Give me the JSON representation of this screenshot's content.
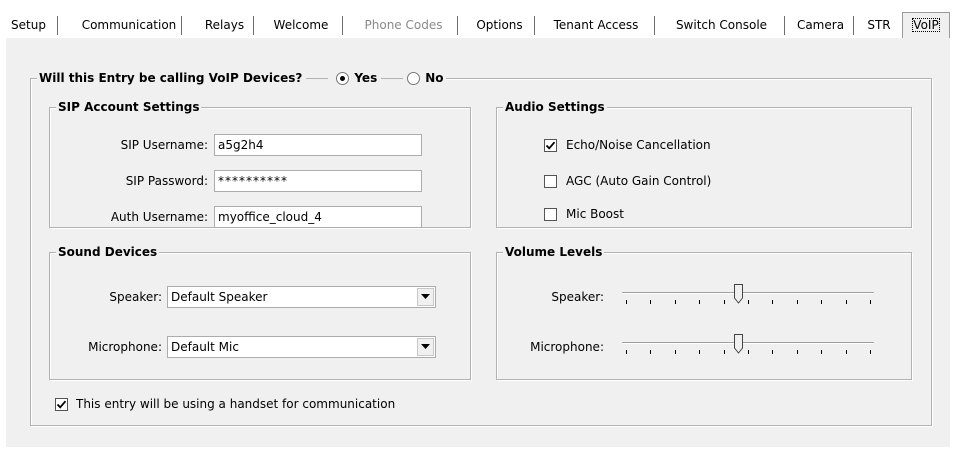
{
  "tabs": [
    {
      "label": "Setup",
      "state": "normal"
    },
    {
      "label": "Communication",
      "state": "normal"
    },
    {
      "label": "Relays",
      "state": "normal"
    },
    {
      "label": "Welcome",
      "state": "normal"
    },
    {
      "label": "Phone Codes",
      "state": "disabled"
    },
    {
      "label": "Options",
      "state": "normal"
    },
    {
      "label": "Tenant Access",
      "state": "normal"
    },
    {
      "label": "Switch Console",
      "state": "normal"
    },
    {
      "label": "Camera",
      "state": "normal"
    },
    {
      "label": "STR",
      "state": "normal"
    },
    {
      "label": "VoIP",
      "state": "active"
    }
  ],
  "voip": {
    "question": "Will this Entry be calling VoIP Devices?",
    "yes_label": "Yes",
    "no_label": "No",
    "selected": "Yes"
  },
  "sip": {
    "title": "SIP Account Settings",
    "username_label": "SIP Username:",
    "username_value": "a5g2h4",
    "password_label": "SIP Password:",
    "password_value": "**********",
    "auth_label": "Auth Username:",
    "auth_value": "myoffice_cloud_4"
  },
  "audio": {
    "title": "Audio Settings",
    "echo_label": "Echo/Noise Cancellation",
    "echo_checked": true,
    "agc_label": "AGC (Auto Gain Control)",
    "agc_checked": false,
    "mic_boost_label": "Mic Boost",
    "mic_boost_checked": false
  },
  "sound": {
    "title": "Sound Devices",
    "speaker_label": "Speaker:",
    "speaker_value": "Default Speaker",
    "mic_label": "Microphone:",
    "mic_value": "Default Mic"
  },
  "volume": {
    "title": "Volume Levels",
    "speaker_label": "Speaker:",
    "speaker_level": 0.46,
    "mic_label": "Microphone:",
    "mic_level": 0.46,
    "tick_count": 11
  },
  "handset": {
    "label": "This entry will be using a handset for communication",
    "checked": true
  }
}
